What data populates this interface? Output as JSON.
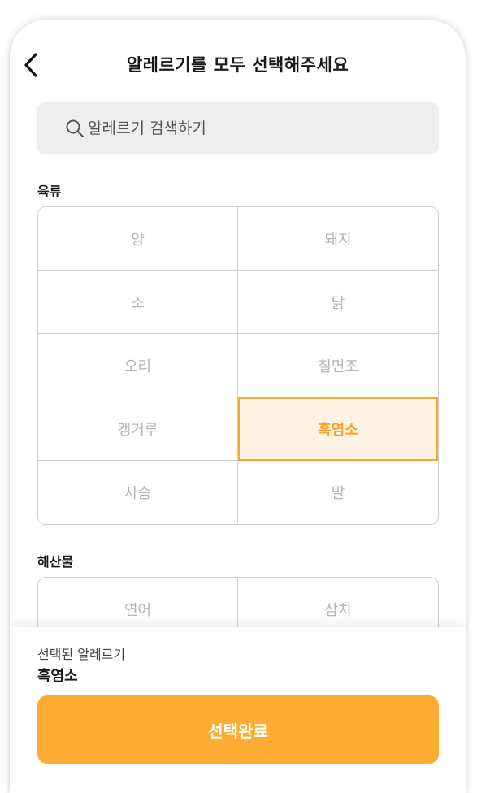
{
  "header": {
    "title": "알레르기를 모두 선택해주세요"
  },
  "search": {
    "placeholder": "알레르기 검색하기"
  },
  "sections": [
    {
      "title": "육류",
      "items": [
        {
          "label": "양",
          "selected": false
        },
        {
          "label": "돼지",
          "selected": false
        },
        {
          "label": "소",
          "selected": false
        },
        {
          "label": "닭",
          "selected": false
        },
        {
          "label": "오리",
          "selected": false
        },
        {
          "label": "칠면조",
          "selected": false
        },
        {
          "label": "캥거루",
          "selected": false
        },
        {
          "label": "흑염소",
          "selected": true
        },
        {
          "label": "사슴",
          "selected": false
        },
        {
          "label": "말",
          "selected": false
        }
      ]
    },
    {
      "title": "해산물",
      "items": [
        {
          "label": "연어",
          "selected": false
        },
        {
          "label": "삼치",
          "selected": false
        }
      ]
    }
  ],
  "bottom": {
    "selected_label": "선택된 알레르기",
    "selected_value": "흑염소",
    "done_label": "선택완료"
  },
  "colors": {
    "accent": "#fdac33",
    "selected_bg": "#fef3e2",
    "selected_text": "#f7a22b",
    "search_bg": "#eeeeee"
  },
  "icons": {
    "back": "chevron-left-icon",
    "search": "search-icon"
  }
}
